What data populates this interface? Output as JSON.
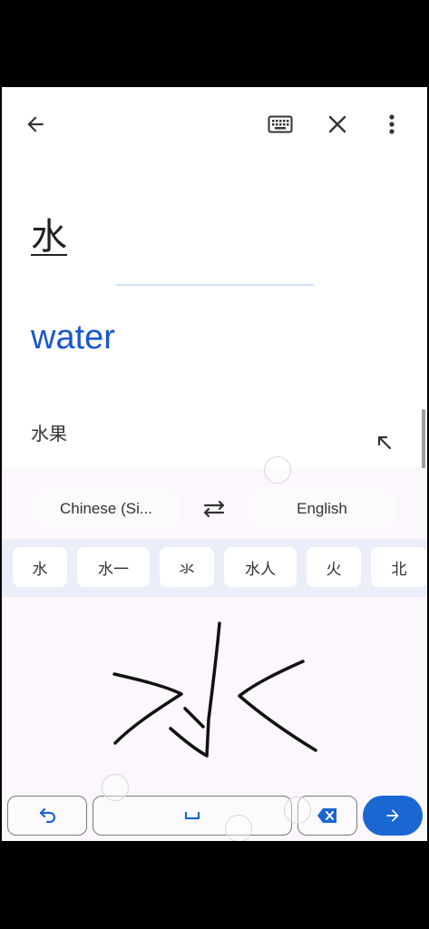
{
  "icons": {
    "back": "arrow-left-icon",
    "keyboard": "keyboard-icon",
    "close": "close-icon",
    "more": "more-vert-icon",
    "expand": "arrow-up-left-icon",
    "swap": "swap-icon",
    "undo": "undo-icon",
    "space": "space-bar-icon",
    "backspace": "backspace-icon",
    "go": "arrow-right-icon"
  },
  "colors": {
    "accent": "#1a67d2",
    "translation_text": "#1a57c9",
    "candidate_bar": "#e9eef9"
  },
  "input": {
    "source_text": "水"
  },
  "output": {
    "translation": "water",
    "suggestion": "水果"
  },
  "languages": {
    "source": "Chinese (Si...",
    "target": "English"
  },
  "candidates": [
    "水",
    "水一",
    "氺",
    "水人",
    "火",
    "北"
  ]
}
